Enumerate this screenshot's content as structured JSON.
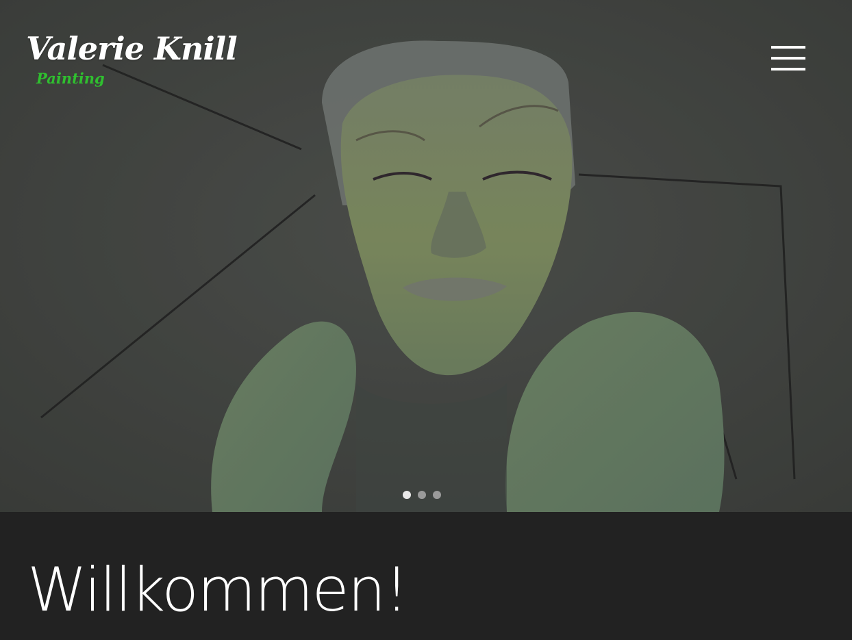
{
  "header": {
    "title": "Valerie Knill",
    "tagline": "Painting",
    "menu_icon": "hamburger-icon"
  },
  "slider": {
    "slides": 3,
    "active_slide": 1,
    "image_subject": "painting-of-green-figure"
  },
  "main": {
    "heading": "Willkommen!"
  },
  "colors": {
    "tagline": "#2fbf2f",
    "background": "#222222",
    "text": "#ffffff"
  }
}
